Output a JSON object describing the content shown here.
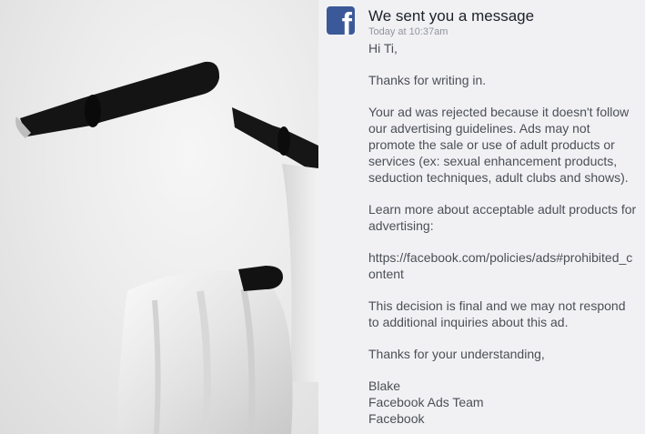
{
  "message": {
    "title": "We sent you a message",
    "timestamp": "Today at 10:37am",
    "greeting": "Hi Ti,",
    "paragraph1": "Thanks for writing in.",
    "paragraph2": "Your ad was rejected because it doesn't follow our advertising guidelines. Ads may not promote the sale or use of adult products or services (ex: sexual enhancement products, seduction techniques, adult clubs and shows).",
    "paragraph3": "Learn more about acceptable adult products for advertising:",
    "link": "https://facebook.com/policies/ads#prohibited_content",
    "paragraph4": "This decision is final and we may not respond to additional inquiries about this ad.",
    "closing": "Thanks for your understanding,",
    "signature": [
      "Blake",
      "Facebook Ads Team",
      "Facebook"
    ]
  },
  "icon": {
    "name": "facebook-logo-icon",
    "glyph": "f",
    "color": "#3b5998"
  }
}
